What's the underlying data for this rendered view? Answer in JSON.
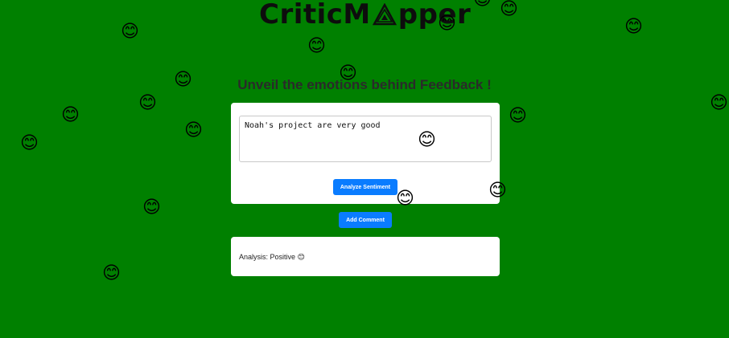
{
  "header": {
    "logo_text_left": "CriticM",
    "logo_text_right": "pper",
    "logo_mark": "triangle-logo-icon",
    "tagline": "Unveil the emotions behind Feedback !"
  },
  "comment_input": {
    "value": "Noah's project are very good"
  },
  "buttons": {
    "analyze_label": "Analyze Sentiment",
    "add_comment_label": "Add Comment"
  },
  "result": {
    "text": "Analysis: Positive 😊"
  },
  "floating_emojis": {
    "glyph": "😊",
    "icon": "smiling-face-icon"
  },
  "colors": {
    "background": "#008000",
    "button": "#0a7cff",
    "card": "#ffffff"
  }
}
